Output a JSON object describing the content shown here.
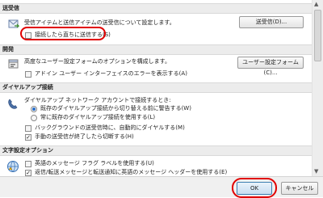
{
  "sections": {
    "send_receive": {
      "header": "送受信",
      "description": "受信アイテムと送信アイテムの送受信について設定します。",
      "button": "送受信(D)...",
      "checkbox": "接続したら直ちに送信する(S)"
    },
    "developer": {
      "header": "開発",
      "description": "高度なユーザー設定フォームのオプションを構成します。",
      "button": "ユーザー設定フォーム(C)...",
      "checkbox": "アドイン ユーザー インターフェイスのエラーを表示する(A)"
    },
    "dialup": {
      "header": "ダイヤルアップ接続",
      "description": "ダイヤルアップ ネットワーク アカウントで接続するとき:",
      "radio1": "既存のダイヤルアップ接続から切り替える前に警告する(W)",
      "radio2": "常に既存のダイヤルアップ接続を使用する(L)",
      "checkbox1": "バックグラウンドの送受信時に、自動的にダイヤルする(M)",
      "checkbox2": "手動の送受信が終了したら切断する(H)"
    },
    "international": {
      "header": "文字設定オプション",
      "checkbox1": "英語のメッセージ フラグ ラベルを使用する(U)",
      "checkbox2": "返信/転送メッセージと転送通知に英語のメッセージ ヘッダーを使用する(E)"
    }
  },
  "footer": {
    "ok": "OK",
    "cancel": "キャンセル"
  },
  "colors": {
    "highlight": "#e00000",
    "section_bg": "#ececec"
  },
  "icons": [
    "send-receive-icon",
    "developer-icon",
    "phone-icon",
    "international-icon"
  ],
  "state": {
    "send_immediately_checked": false,
    "addin_errors_checked": false,
    "radio_selected": "warn-before-switching",
    "auto_dial_checked": false,
    "hangup_checked": true,
    "english_flag_checked": false,
    "english_header_checked": true
  }
}
